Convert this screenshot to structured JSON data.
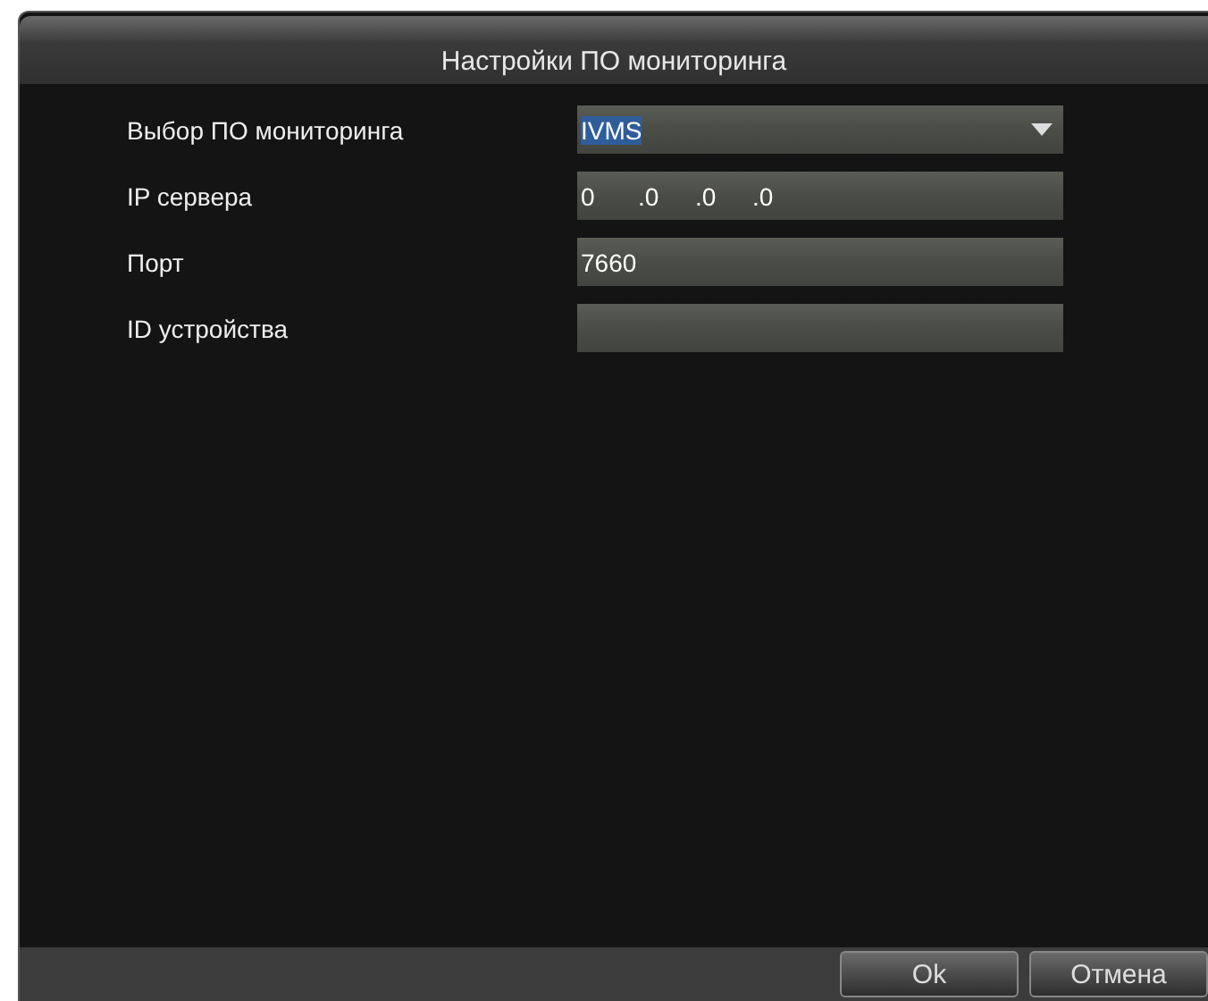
{
  "window": {
    "title": "Настройки ПО мониторинга"
  },
  "fields": [
    {
      "kind": "select",
      "label": "Выбор ПО мониторинга",
      "value": "IVMS",
      "highlighted": true
    },
    {
      "kind": "ip",
      "label": "IP сервера",
      "segments": [
        "0",
        ".0",
        ".0",
        ".0"
      ]
    },
    {
      "kind": "text",
      "label": "Порт",
      "value": "7660"
    },
    {
      "kind": "text",
      "label": "ID устройства"
    }
  ],
  "buttons": [
    "Ok",
    "Отмена"
  ]
}
